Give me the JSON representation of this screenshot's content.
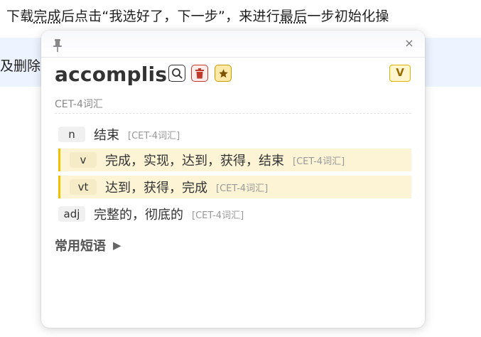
{
  "background": {
    "line1_a": "下载",
    "line1_u1": "完成",
    "line1_b": "后点击“我选好了，下一步”，来进行",
    "line1_u2": "最后",
    "line1_c": "一步初始化操",
    "line2": "及删除"
  },
  "popup": {
    "close_glyph": "×",
    "word": "accomplish",
    "level_badge": "V",
    "level_text": "CET-4词汇",
    "meanings": [
      {
        "pos": "n",
        "text": "结束",
        "tag": "[CET-4词汇]",
        "highlight": false
      },
      {
        "pos": "v",
        "text": "完成，实现，达到，获得，结束",
        "tag": "[CET-4词汇]",
        "highlight": true
      },
      {
        "pos": "vt",
        "text": "达到，获得，完成",
        "tag": "[CET-4词汇]",
        "highlight": true
      },
      {
        "pos": "adj",
        "text": "完整的，彻底的",
        "tag": "[CET-4词汇]",
        "highlight": false
      }
    ],
    "phrases_label": "常用短语",
    "phrases_arrow": "▶"
  },
  "icons": {
    "pin": "pin-icon",
    "search": "search-icon",
    "delete": "trash-icon",
    "star": "star-icon",
    "close": "close-icon"
  },
  "colors": {
    "highlight_bg": "#fdf4d6",
    "highlight_bar": "#f0c000",
    "delete_red": "#c0392b",
    "star_gold": "#c79a00"
  }
}
